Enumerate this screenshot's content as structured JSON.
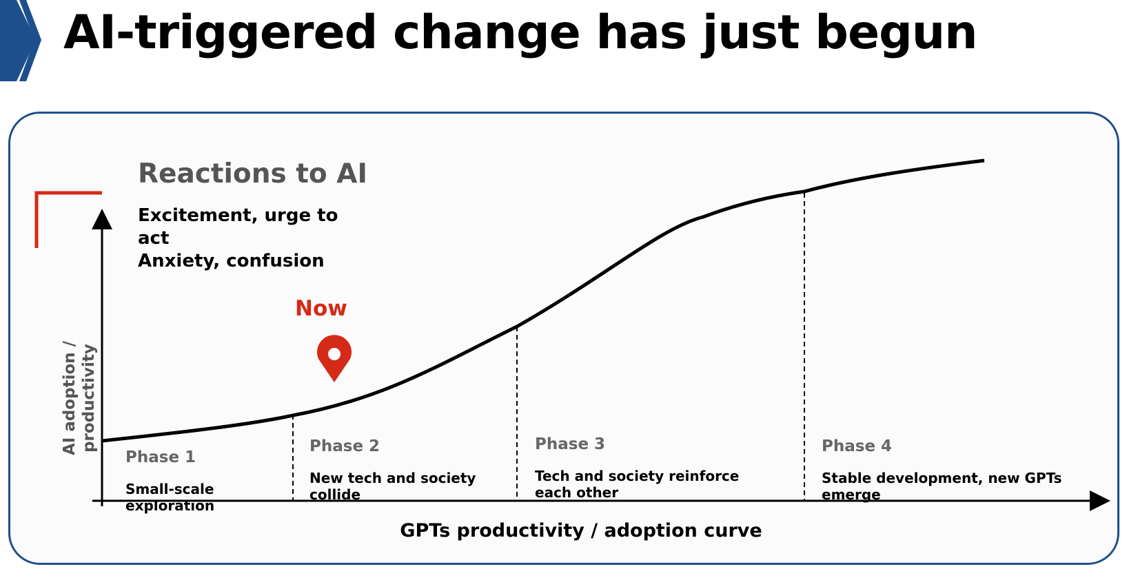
{
  "title": "AI-triggered change has just begun",
  "diagram": {
    "reactions_heading": "Reactions to AI",
    "reactions": [
      "Excitement, urge to",
      "act",
      "Anxiety, confusion"
    ],
    "now_marker_label": "Now",
    "y_axis_label": [
      "AI adoption /",
      "productivity"
    ],
    "x_axis_label": "GPTs productivity / adoption curve",
    "phases": [
      {
        "title": "Phase 1",
        "description": "Small-scale exploration"
      },
      {
        "title": "Phase 2",
        "description": "New tech and society collide"
      },
      {
        "title": "Phase 3",
        "description": "Tech and society reinforce each other"
      },
      {
        "title": "Phase 4",
        "description": "Stable development, new GPTs emerge"
      }
    ]
  },
  "colors": {
    "accent_red": "#d42a18",
    "brand_blue": "#1f4e8c",
    "curve": "#000000"
  }
}
